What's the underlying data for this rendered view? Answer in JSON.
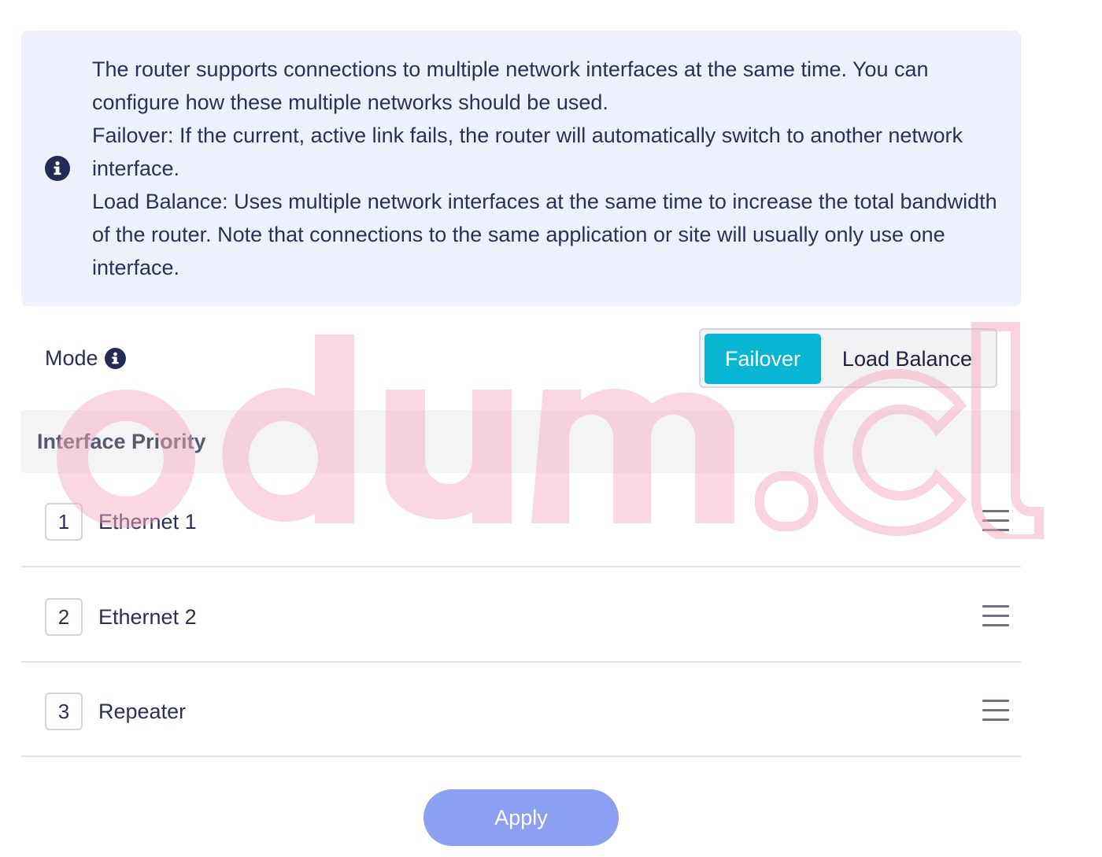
{
  "info": {
    "icon": "info-circle-icon",
    "line1": "The router supports connections to multiple network interfaces at the same time. You can configure how these multiple networks should be used.",
    "line2": "Failover: If the current, active link fails, the router will automatically switch to another network interface.",
    "line3": "Load Balance: Uses multiple network interfaces at the same time to increase the total bandwidth of the router. Note that connections to the same application or site will usually only use one interface."
  },
  "mode": {
    "label": "Mode",
    "options": [
      "Failover",
      "Load Balance"
    ],
    "selected": "Failover"
  },
  "priority": {
    "title": "Interface Priority",
    "items": [
      {
        "num": "1",
        "name": "Ethernet 1"
      },
      {
        "num": "2",
        "name": "Ethernet 2"
      },
      {
        "num": "3",
        "name": "Repeater"
      }
    ]
  },
  "apply_label": "Apply",
  "watermark_text": "odum.cl",
  "colors": {
    "accent": "#08b5d3",
    "apply": "#8ca0f2",
    "info_bg": "#edf1fc",
    "watermark": "#f4a9bd"
  }
}
